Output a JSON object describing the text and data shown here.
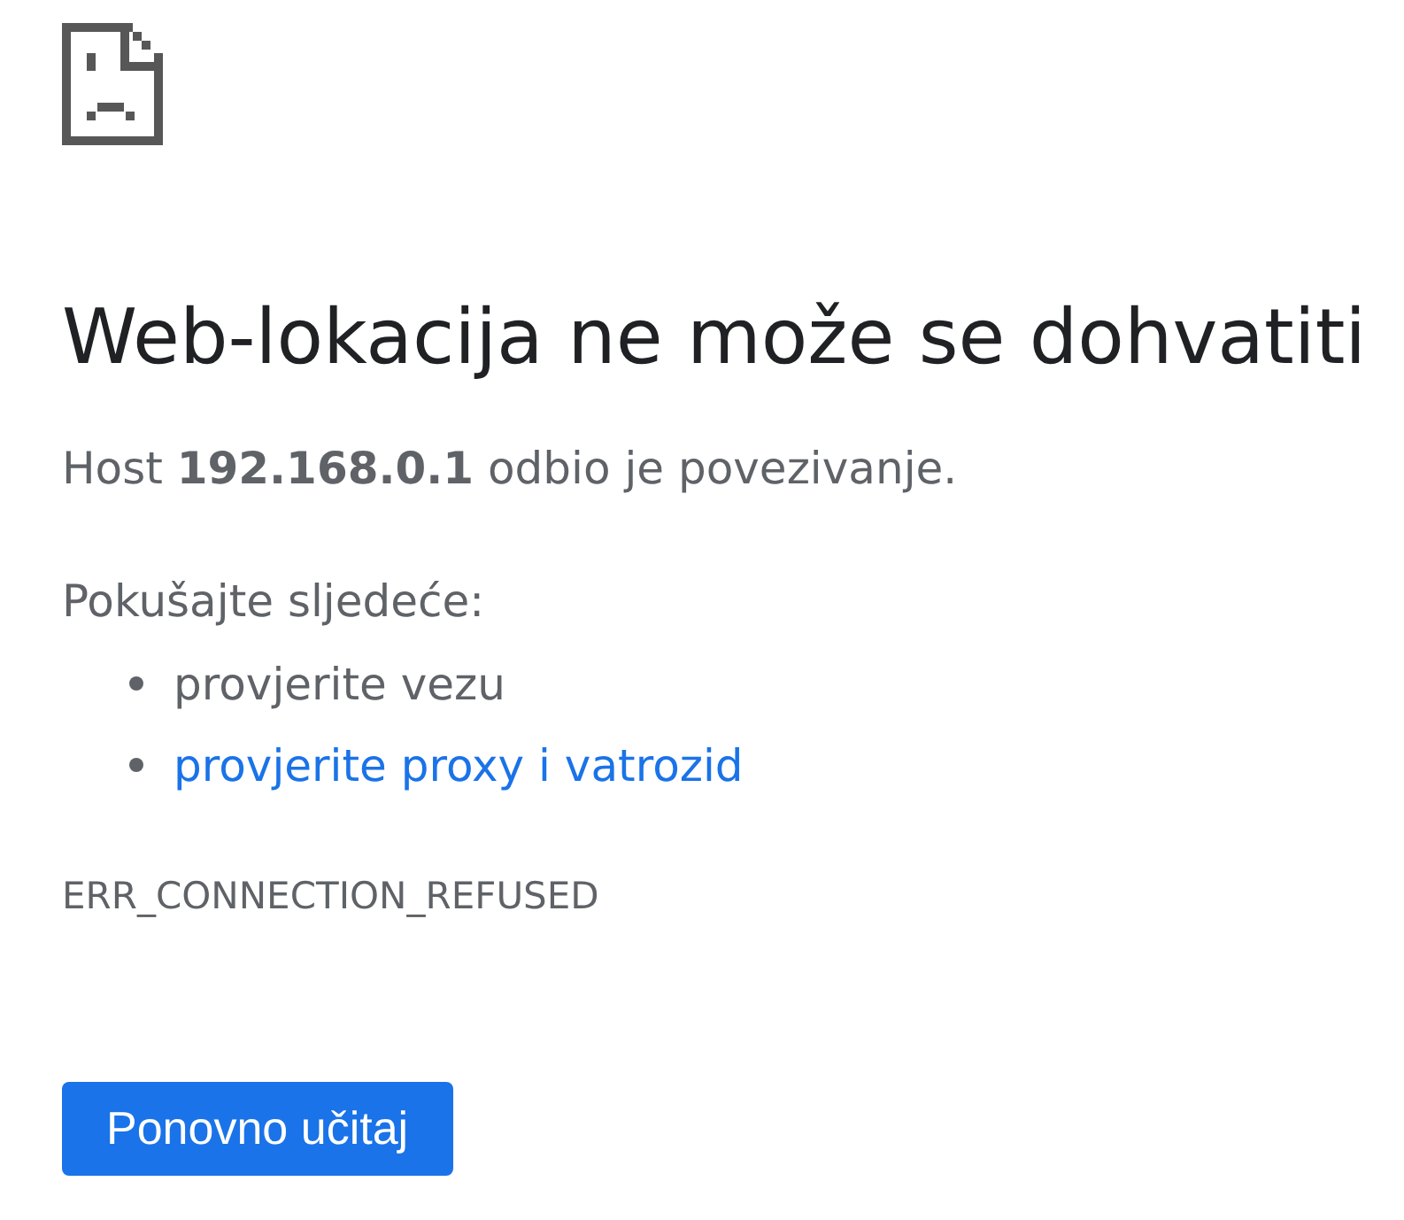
{
  "heading": "Web-lokacija ne može se dohvatiti",
  "summary": "Host **192.168.0.1** odbio je povezivanje.",
  "suggestions": {
    "intro": "Pokušajte sljedeće:",
    "items": [
      {
        "kind": "text",
        "text": "provjerite vezu"
      },
      {
        "kind": "link",
        "text": "provjerite proxy i vatrozid"
      }
    ]
  },
  "error_code": "ERR_CONNECTION_REFUSED",
  "buttons": [
    {
      "label": "Ponovno učitaj"
    }
  ]
}
